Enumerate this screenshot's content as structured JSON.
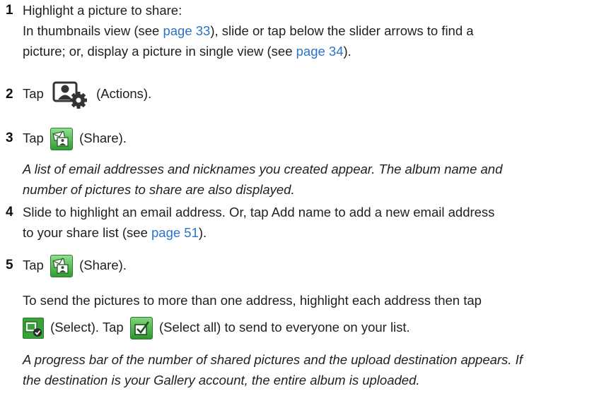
{
  "steps": [
    {
      "number": "1",
      "line1": "Highlight a picture to share:",
      "line2_pre": "In thumbnails view (see ",
      "line2_link": "page 33",
      "line2_post": "), slide or tap below the slider arrows to find a",
      "line3_pre": "picture; or, display a picture in single view (see ",
      "line3_link": "page 34",
      "line3_post": ")."
    },
    {
      "number": "2",
      "pre": "Tap",
      "icon": "actions-icon",
      "post": "(Actions)."
    },
    {
      "number": "3",
      "pre": "Tap",
      "icon": "share-icon",
      "post": "(Share).",
      "note_line1": "A list of email addresses and nicknames you created appear. The album name and",
      "note_line2": "number of pictures to share are also displayed."
    },
    {
      "number": "4",
      "line1": "Slide to highlight an email address. Or, tap Add name to add a new email address",
      "line2_pre": "to your share list (see ",
      "line2_link": "page 51",
      "line2_post": ")."
    },
    {
      "number": "5",
      "pre": "Tap",
      "icon": "share-icon",
      "post": "(Share).",
      "para_line1": "To send the pictures to more than one address, highlight each address then tap",
      "para_select": "(Select). Tap",
      "para_selectall": "(Select all) to send to everyone on your list.",
      "note_line1": "A progress bar of the number of shared pictures and the upload destination appears. If",
      "note_line2": "the destination is your Gallery account, the entire album is uploaded."
    }
  ],
  "colors": {
    "link": "#2a73c9",
    "accent_green": "#3aa23a"
  }
}
